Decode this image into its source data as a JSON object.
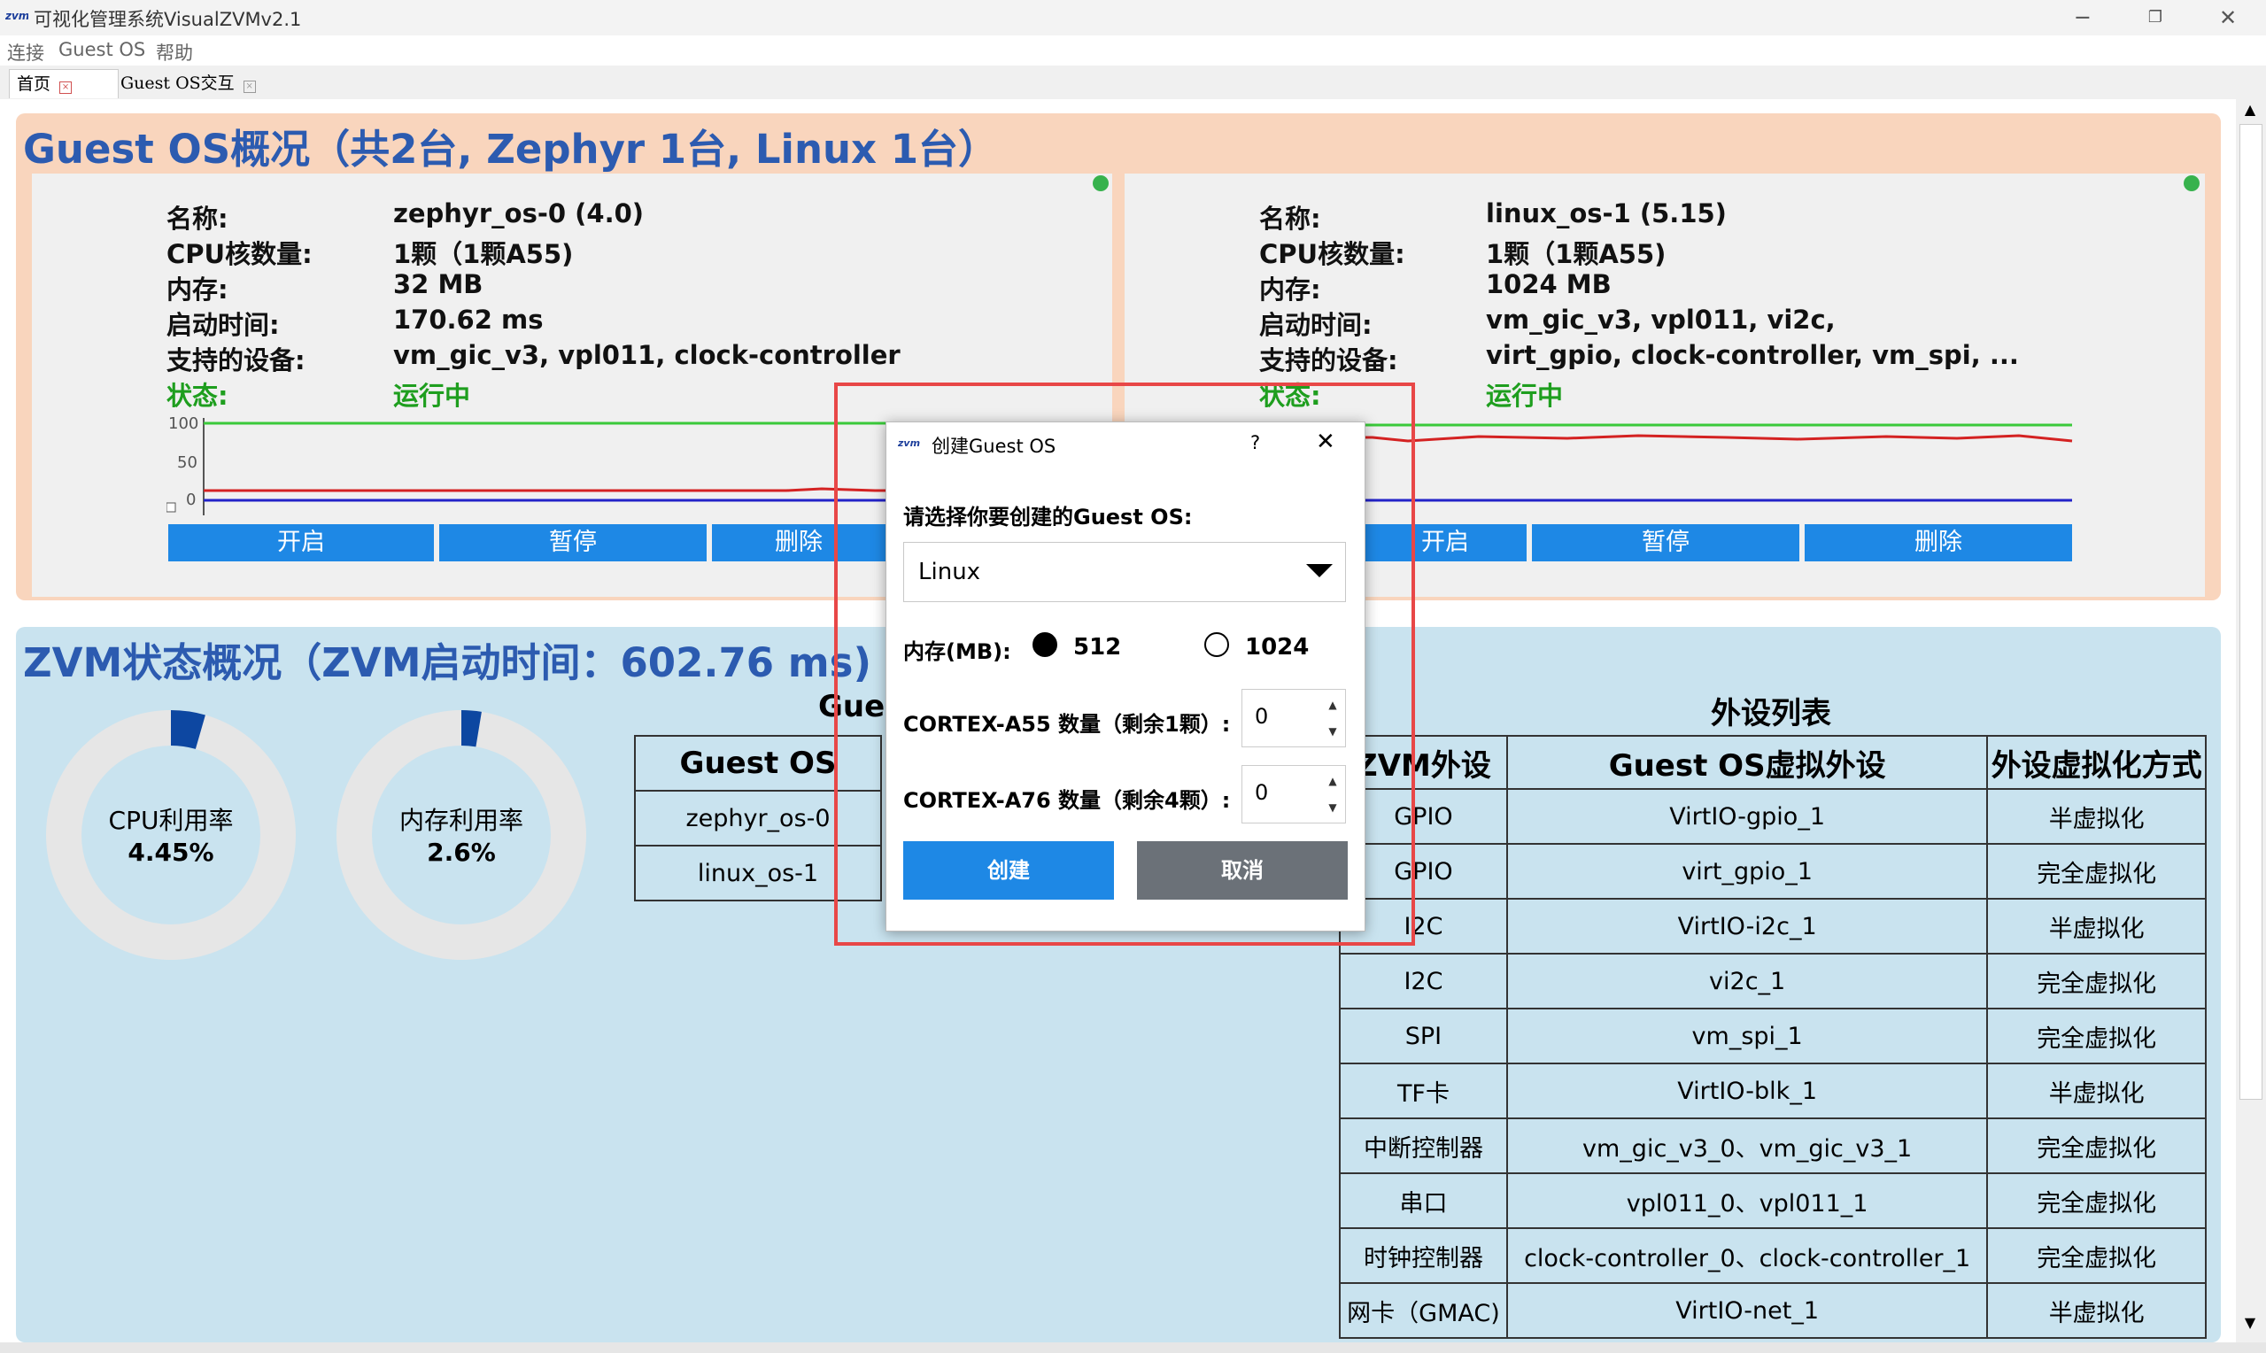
{
  "window": {
    "title": "可视化管理系统VisualZVMv2.1",
    "icon": "visualzvm-logo-icon"
  },
  "menu": [
    "连接",
    "Guest OS",
    "帮助"
  ],
  "tabs": [
    {
      "label": "首页"
    },
    {
      "label": "Guest OS交互"
    }
  ],
  "guest_section": {
    "title": "Guest OS概况（共2台, Zephyr 1台, Linux 1台）",
    "keys": {
      "name": "名称:",
      "cpu": "CPU核数量:",
      "mem": "内存:",
      "boot": "启动时间:",
      "devices": "支持的设备:",
      "status": "状态:"
    },
    "buttons": {
      "start": "开启",
      "pause": "暂停",
      "delete": "删除"
    },
    "yticks": [
      "100",
      "50",
      "0"
    ],
    "vms": [
      {
        "name": "zephyr_os-0 (4.0)",
        "cpu": "1颗（1颗A55)",
        "mem": "32 MB",
        "boot": "170.62 ms",
        "devices": "vm_gic_v3, vpl011, clock-controller",
        "devices2": "",
        "status": "运行中"
      },
      {
        "name": "linux_os-1 (5.15)",
        "cpu": "1颗（1颗A55)",
        "mem": "1024 MB",
        "boot": "",
        "devices": "vm_gic_v3, vpl011, vi2c,",
        "devices2": "virt_gpio, clock-controller, vm_spi, ...",
        "status": "运行中"
      }
    ]
  },
  "zvm_section": {
    "title": "ZVM状态概况（ZVM启动时间：602.76 ms)",
    "cpu": {
      "label": "CPU利用率",
      "value": "4.45%",
      "fraction": 0.0445
    },
    "mem": {
      "label": "内存利用率",
      "value": "2.6%",
      "fraction": 0.026
    },
    "guest_table": {
      "caption": "Gues",
      "header": "Guest OS",
      "rows": [
        "zephyr_os-0",
        "linux_os-1"
      ]
    },
    "peripherals": {
      "caption": "外设列表",
      "headers": [
        "ZVM外设",
        "Guest OS虚拟外设",
        "外设虚拟化方式"
      ],
      "rows": [
        [
          "GPIO",
          "VirtIO-gpio_1",
          "半虚拟化"
        ],
        [
          "GPIO",
          "virt_gpio_1",
          "完全虚拟化"
        ],
        [
          "I2C",
          "VirtIO-i2c_1",
          "半虚拟化"
        ],
        [
          "I2C",
          "vi2c_1",
          "完全虚拟化"
        ],
        [
          "SPI",
          "vm_spi_1",
          "完全虚拟化"
        ],
        [
          "TF卡",
          "VirtIO-blk_1",
          "半虚拟化"
        ],
        [
          "中断控制器",
          "vm_gic_v3_0、vm_gic_v3_1",
          "完全虚拟化"
        ],
        [
          "串口",
          "vpl011_0、vpl011_1",
          "完全虚拟化"
        ],
        [
          "时钟控制器",
          "clock-controller_0、clock-controller_1",
          "完全虚拟化"
        ],
        [
          "网卡（GMAC)",
          "VirtIO-net_1",
          "半虚拟化"
        ]
      ]
    }
  },
  "dialog": {
    "title": "创建Guest OS",
    "help": "?",
    "prompt": "请选择你要创建的Guest OS:",
    "os_selected": "Linux",
    "mem_label": "内存(MB):",
    "mem_options": [
      "512",
      "1024"
    ],
    "mem_selected": "512",
    "a55_label": "CORTEX-A55 数量（剩余1颗）:",
    "a55_value": "0",
    "a76_label": "CORTEX-A76 数量（剩余4颗）:",
    "a76_value": "0",
    "create": "创建",
    "cancel": "取消",
    "colors": {
      "create": "#1e88e5",
      "cancel": "#6b7178"
    }
  }
}
